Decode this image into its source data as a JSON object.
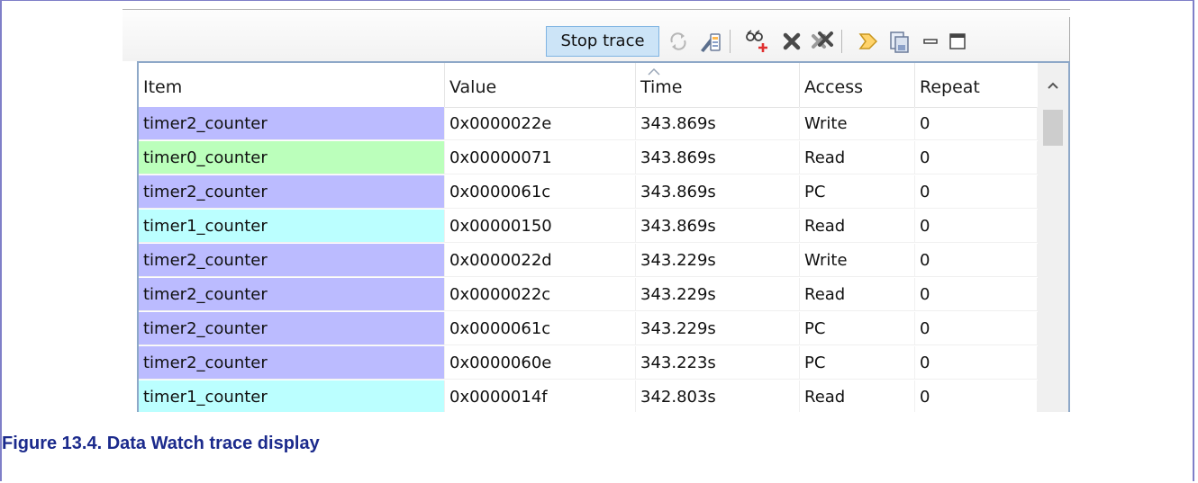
{
  "toolbar": {
    "stop_trace_label": "Stop trace",
    "icons": [
      "refresh-icon",
      "trace-settings-icon",
      "add-watch-icon",
      "remove-icon",
      "remove-all-icon",
      "go-to-icon",
      "export-icon",
      "minimize-icon",
      "maximize-icon"
    ]
  },
  "table": {
    "columns": [
      "Item",
      "Value",
      "Time",
      "Access",
      "Repeat"
    ],
    "sorted_column": "Time",
    "rows": [
      {
        "item": "timer2_counter",
        "value": "0x0000022e",
        "time": "343.869s",
        "access": "Write",
        "repeat": "0",
        "color": "#bbbbff"
      },
      {
        "item": "timer0_counter",
        "value": "0x00000071",
        "time": "343.869s",
        "access": "Read",
        "repeat": "0",
        "color": "#bbffbb"
      },
      {
        "item": "timer2_counter",
        "value": "0x0000061c",
        "time": "343.869s",
        "access": "PC",
        "repeat": "0",
        "color": "#bbbbff"
      },
      {
        "item": "timer1_counter",
        "value": "0x00000150",
        "time": "343.869s",
        "access": "Read",
        "repeat": "0",
        "color": "#bbffff"
      },
      {
        "item": "timer2_counter",
        "value": "0x0000022d",
        "time": "343.229s",
        "access": "Write",
        "repeat": "0",
        "color": "#bbbbff"
      },
      {
        "item": "timer2_counter",
        "value": "0x0000022c",
        "time": "343.229s",
        "access": "Read",
        "repeat": "0",
        "color": "#bbbbff"
      },
      {
        "item": "timer2_counter",
        "value": "0x0000061c",
        "time": "343.229s",
        "access": "PC",
        "repeat": "0",
        "color": "#bbbbff"
      },
      {
        "item": "timer2_counter",
        "value": "0x0000060e",
        "time": "343.223s",
        "access": "PC",
        "repeat": "0",
        "color": "#bbbbff"
      },
      {
        "item": "timer1_counter",
        "value": "0x0000014f",
        "time": "342.803s",
        "access": "Read",
        "repeat": "0",
        "color": "#bbffff"
      }
    ]
  },
  "caption": "Figure 13.4. Data Watch trace display"
}
